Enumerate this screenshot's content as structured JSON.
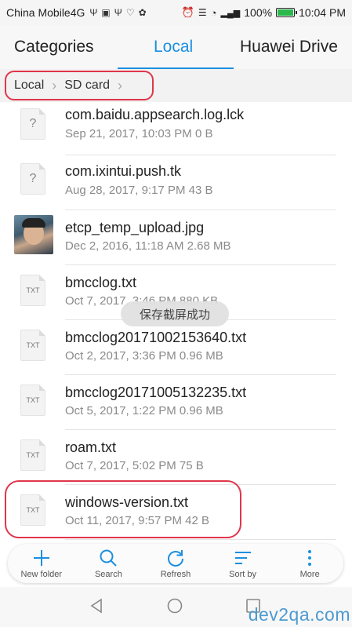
{
  "status_bar": {
    "carrier": "China Mobile4G",
    "left_icons": [
      "usb-icon",
      "image-icon",
      "usb-icon",
      "heart-icon",
      "app-icon"
    ],
    "battery": "100%",
    "battery_level": 1.0,
    "time": "10:04 PM"
  },
  "tabs": [
    {
      "label": "Categories"
    },
    {
      "label": "Local"
    },
    {
      "label": "Huawei Drive"
    }
  ],
  "breadcrumb": [
    {
      "label": "Local"
    },
    {
      "label": "SD card"
    }
  ],
  "files": [
    {
      "name": "com.baidu.appsearch.log.lck",
      "meta": "Sep 21, 2017, 10:03 PM 0 B",
      "icon": "unknown-file-icon",
      "badge": "?"
    },
    {
      "name": "com.ixintui.push.tk",
      "meta": "Aug 28, 2017, 9:17 PM 43 B",
      "icon": "unknown-file-icon",
      "badge": "?"
    },
    {
      "name": "etcp_temp_upload.jpg",
      "meta": "Dec 2, 2016, 11:18 AM 2.68 MB",
      "icon": "image-thumbnail",
      "badge": ""
    },
    {
      "name": "bmcclog.txt",
      "meta": "Oct 7, 2017, 3:46 PM 880 KB",
      "icon": "txt-file-icon",
      "badge": "TXT"
    },
    {
      "name": "bmcclog20171002153640.txt",
      "meta": "Oct 2, 2017, 3:36 PM 0.96 MB",
      "icon": "txt-file-icon",
      "badge": "TXT"
    },
    {
      "name": "bmcclog20171005132235.txt",
      "meta": "Oct 5, 2017, 1:22 PM 0.96 MB",
      "icon": "txt-file-icon",
      "badge": "TXT"
    },
    {
      "name": "roam.txt",
      "meta": "Oct 7, 2017, 5:02 PM 75 B",
      "icon": "txt-file-icon",
      "badge": "TXT"
    },
    {
      "name": "windows-version.txt",
      "meta": "Oct 11, 2017, 9:57 PM 42 B",
      "icon": "txt-file-icon",
      "badge": "TXT"
    }
  ],
  "toast": "保存截屏成功",
  "toolbar": [
    {
      "label": "New folder",
      "icon": "plus-icon"
    },
    {
      "label": "Search",
      "icon": "search-icon"
    },
    {
      "label": "Refresh",
      "icon": "refresh-icon"
    },
    {
      "label": "Sort by",
      "icon": "sort-icon"
    },
    {
      "label": "More",
      "icon": "more-vertical-icon"
    }
  ],
  "accent_color": "#1a8fe0",
  "highlight_color": "#e0364a",
  "watermark": "dev2qa.com"
}
